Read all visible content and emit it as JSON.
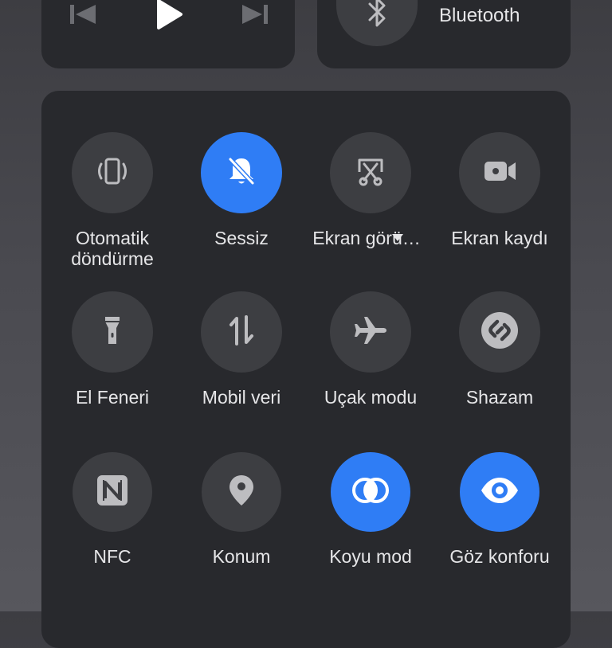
{
  "media": {
    "prev_icon": "skip-previous-icon",
    "play_icon": "play-icon",
    "next_icon": "skip-next-icon"
  },
  "bluetooth": {
    "label": "Bluetooth",
    "icon": "bluetooth-icon"
  },
  "tiles": [
    {
      "label": "Otomatik döndürme",
      "icon": "auto-rotate-icon",
      "active": false
    },
    {
      "label": "Sessiz",
      "icon": "bell-off-icon",
      "active": true
    },
    {
      "label": "Ekran görü…",
      "icon": "screenshot-icon",
      "active": false,
      "has_dropdown": true
    },
    {
      "label": "Ekran kaydı",
      "icon": "screen-record-icon",
      "active": false
    },
    {
      "label": "El Feneri",
      "icon": "flashlight-icon",
      "active": false
    },
    {
      "label": "Mobil veri",
      "icon": "mobile-data-icon",
      "active": false
    },
    {
      "label": "Uçak modu",
      "icon": "airplane-icon",
      "active": false
    },
    {
      "label": "Shazam",
      "icon": "shazam-icon",
      "active": false
    },
    {
      "label": "NFC",
      "icon": "nfc-icon",
      "active": false
    },
    {
      "label": "Konum",
      "icon": "location-icon",
      "active": false
    },
    {
      "label": "Koyu mod",
      "icon": "dark-mode-icon",
      "active": true
    },
    {
      "label": "Göz konforu",
      "icon": "eye-icon",
      "active": true
    }
  ],
  "colors": {
    "active": "#2f7df5",
    "tile_bg": "#3d3e42",
    "card_bg": "#28292d"
  }
}
